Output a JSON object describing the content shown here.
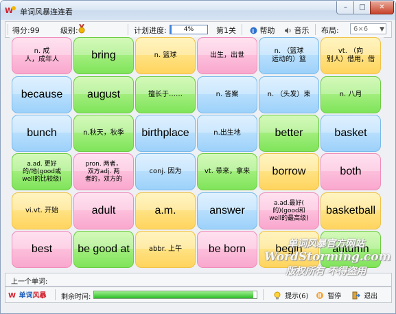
{
  "window": {
    "title": "单词风暴连连看",
    "min_glyph": "–",
    "max_glyph": "□",
    "close_glyph": "✕"
  },
  "infobar": {
    "score_label": "得分:99",
    "level_label": "级别:",
    "level_icon": "medal-icon",
    "plan_label": "计划进度:",
    "progress_text": "4%",
    "progress_value": 0.04,
    "stage_label": "第1关",
    "help_label": "帮助",
    "music_label": "音乐",
    "layout_label": "布局:",
    "layout_value": "6×6"
  },
  "tiles": [
    [
      {
        "t": "n. 成\n人，成年人",
        "c": "pink",
        "k": "cn"
      },
      {
        "t": "bring",
        "c": "green",
        "k": "en"
      },
      {
        "t": "n. 篮球",
        "c": "yellow",
        "k": "cn"
      },
      {
        "t": "出生，出世",
        "c": "pink",
        "k": "cn"
      },
      {
        "t": "n. （篮球\n运动的）篮",
        "c": "blue",
        "k": "cn"
      },
      {
        "t": "vt. （向\n别人）借用，借",
        "c": "yellow",
        "k": "cn"
      }
    ],
    [
      {
        "t": "because",
        "c": "blue",
        "k": "en"
      },
      {
        "t": "august",
        "c": "green",
        "k": "en"
      },
      {
        "t": "擅长于……",
        "c": "green",
        "k": "cn"
      },
      {
        "t": "n. 答案",
        "c": "blue",
        "k": "cn"
      },
      {
        "t": "n. （头发）束",
        "c": "blue",
        "k": "cn"
      },
      {
        "t": "n. 八月",
        "c": "green",
        "k": "cn"
      }
    ],
    [
      {
        "t": "bunch",
        "c": "blue",
        "k": "en"
      },
      {
        "t": "n.秋天，秋季",
        "c": "green",
        "k": "cn"
      },
      {
        "t": "birthplace",
        "c": "blue",
        "k": "en"
      },
      {
        "t": "n.出生地",
        "c": "blue",
        "k": "cn"
      },
      {
        "t": "better",
        "c": "green",
        "k": "en"
      },
      {
        "t": "basket",
        "c": "blue",
        "k": "en"
      }
    ],
    [
      {
        "t": "a.ad. 更好\n的/地(good或\nwell的比较级)",
        "c": "green",
        "k": "cns"
      },
      {
        "t": "pron. 两者，\n双方adj. 两\n者的，双方的",
        "c": "pink",
        "k": "cns"
      },
      {
        "t": "conj. 因为",
        "c": "blue",
        "k": "cn"
      },
      {
        "t": "vt. 带来，拿来",
        "c": "green",
        "k": "cn"
      },
      {
        "t": "borrow",
        "c": "yellow",
        "k": "en"
      },
      {
        "t": "both",
        "c": "pink",
        "k": "en"
      }
    ],
    [
      {
        "t": "vi.vt. 开始",
        "c": "yellow",
        "k": "cn"
      },
      {
        "t": "adult",
        "c": "pink",
        "k": "en"
      },
      {
        "t": "a.m.",
        "c": "yellow",
        "k": "en"
      },
      {
        "t": "answer",
        "c": "blue",
        "k": "en"
      },
      {
        "t": "a.ad.最好(\n的)(good和\nwell的最高级)",
        "c": "pink",
        "k": "cns"
      },
      {
        "t": "basketball",
        "c": "yellow",
        "k": "en"
      }
    ],
    [
      {
        "t": "best",
        "c": "pink",
        "k": "en"
      },
      {
        "t": "be good at",
        "c": "green",
        "k": "en"
      },
      {
        "t": "abbr. 上午",
        "c": "yellow",
        "k": "cn"
      },
      {
        "t": "be born",
        "c": "pink",
        "k": "en"
      },
      {
        "t": "begin",
        "c": "yellow",
        "k": "en"
      },
      {
        "t": "autumn",
        "c": "green",
        "k": "en"
      }
    ]
  ],
  "watermark": {
    "line1": "单词风暴官方网站",
    "line2": "WordStorming.com",
    "line3": "版权所有 不得盗用"
  },
  "lastword": {
    "label": "上一个单词:"
  },
  "bottom": {
    "logo_main": "单词",
    "logo_accent": "风暴",
    "time_label": "剩余时间:",
    "time_value": 0.98,
    "hint_label": "提示(6)",
    "pause_label": "暂停",
    "exit_label": "退出"
  },
  "colors": {
    "pink": "#f9a7cd",
    "green": "#7fe45a",
    "yellow": "#ffd45e",
    "blue": "#9cd1fa",
    "accent": "#3b82e0"
  }
}
